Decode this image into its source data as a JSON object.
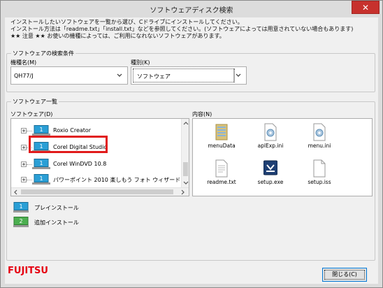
{
  "window": {
    "title": "ソフトウェアディスク検索",
    "close_glyph": "✕"
  },
  "intro": {
    "line1": "インストールしたいソフトウェアを一覧から選び、Cドライブにインストールしてください。",
    "line2": "インストール方法は「readme.txt」「install.txt」などを参照してください。(ソフトウェアによっては用意されていない場合もあります)",
    "line3": "★★ 注意 ★★ お使いの機種によっては、ご利用になれないソフトウェアがあります。"
  },
  "search": {
    "group_label": "ソフトウェアの検索条件",
    "model_label": "機種名(M)",
    "model_value": "QH77/J",
    "type_label": "種別(K)",
    "type_value": "ソフトウェア"
  },
  "software_list": {
    "group_label": "ソフトウェア一覧",
    "tree_label": "ソフトウェア(D)",
    "content_label": "内容(N)",
    "items": [
      {
        "label": "Roxio Creator"
      },
      {
        "label": "Corel Digital Studio"
      },
      {
        "label": "Corel WinDVD 10.8"
      },
      {
        "label": "パワーポイント 2010 楽しもう フォト ウィザード"
      }
    ],
    "files": [
      {
        "name": "menuData",
        "icon": "folder-icon"
      },
      {
        "name": "aplExp.ini",
        "icon": "settings-file-icon"
      },
      {
        "name": "menu.ini",
        "icon": "settings-file-icon"
      },
      {
        "name": "readme.txt",
        "icon": "text-file-icon"
      },
      {
        "name": "setup.exe",
        "icon": "installer-icon"
      },
      {
        "name": "setup.iss",
        "icon": "blank-file-icon"
      }
    ]
  },
  "legend": {
    "preinstall": {
      "badge": "1",
      "label": "プレインストール"
    },
    "additional": {
      "badge": "2",
      "label": "追加インストール"
    }
  },
  "brand": {
    "logo_text": "FUJITSU"
  },
  "footer": {
    "close_label": "閉じる(C)"
  },
  "colors": {
    "highlight": "#e11b1b",
    "preinstall_badge": "#2a9fd6",
    "additional_badge": "#4caf50",
    "brand_red": "#e60012"
  }
}
